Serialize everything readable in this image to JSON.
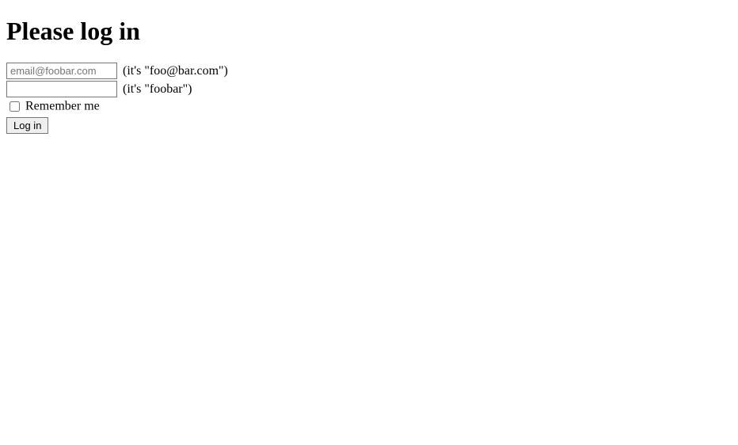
{
  "heading": "Please log in",
  "form": {
    "email": {
      "placeholder": "email@foobar.com",
      "value": "",
      "hint": "(it's \"foo@bar.com\")"
    },
    "password": {
      "value": "",
      "hint": "(it's \"foobar\")"
    },
    "remember": {
      "label": "Remember me"
    },
    "submit_label": "Log in"
  }
}
